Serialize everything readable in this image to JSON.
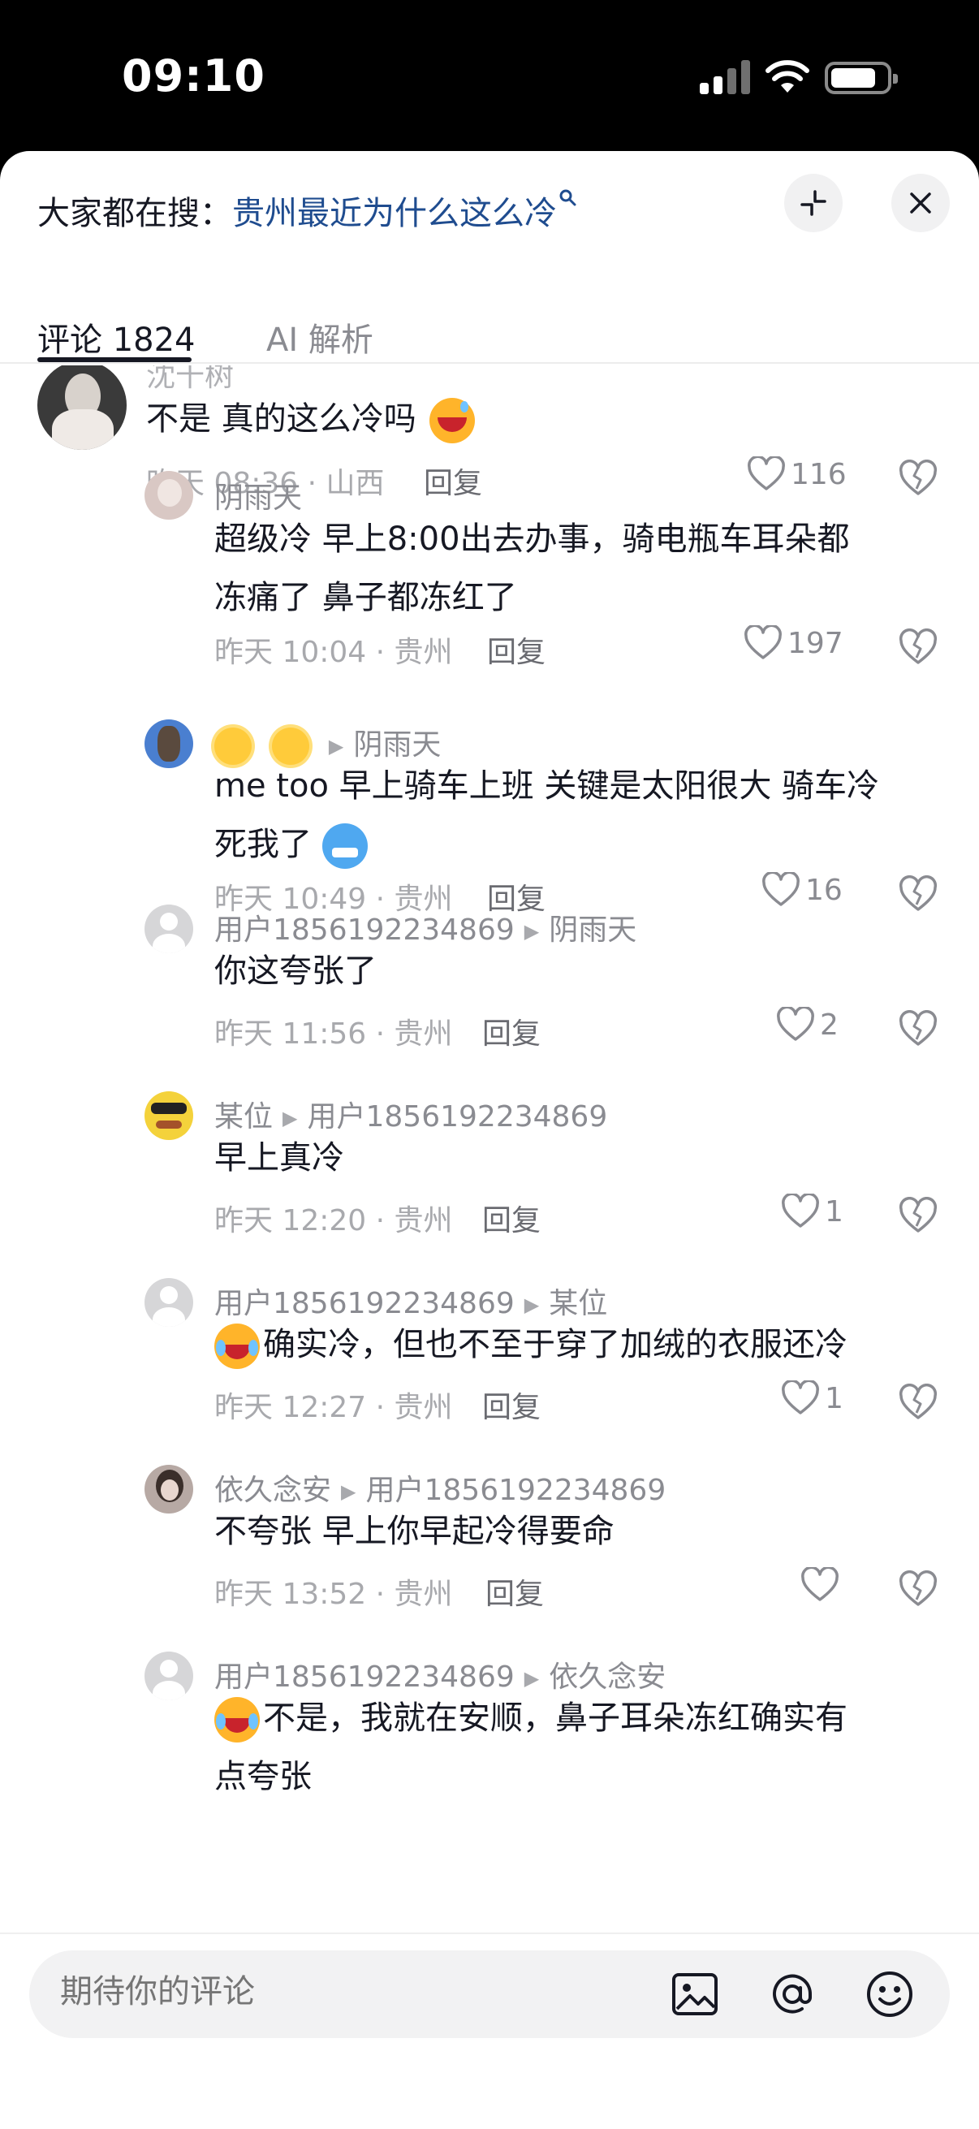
{
  "status_bar": {
    "time": "09:10"
  },
  "header": {
    "search_prefix": "大家都在搜：",
    "search_term": "贵州最近为什么这么冷"
  },
  "tabs": [
    {
      "label": "评论 1824",
      "active": true
    },
    {
      "label": "AI 解析",
      "active": false
    }
  ],
  "comments": [
    {
      "user": "沈十树",
      "text": "不是 真的这么冷吗",
      "time": "昨天 08:36 · 山西",
      "reply": "回复",
      "likes": "116"
    },
    {
      "user": "阴雨天",
      "text_lines": [
        "超级冷 早上8:00出去办事，骑电瓶车耳朵都",
        "冻痛了 鼻子都冻红了"
      ],
      "time": "昨天 10:04 · 贵州",
      "reply": "回复",
      "likes": "197"
    },
    {
      "user": "阴雨天",
      "text_lines": [
        "me too 早上骑车上班 关键是太阳很大 骑车冷",
        "死我了"
      ],
      "time": "昨天 10:49 · 贵州",
      "reply": "回复",
      "likes": "16"
    },
    {
      "user": "用户1856192234869",
      "to": "阴雨天",
      "text": "你这夸张了",
      "time": "昨天 11:56 · 贵州",
      "reply": "回复",
      "likes": "2"
    },
    {
      "user": "某位",
      "to": "用户1856192234869",
      "text": "早上真冷",
      "time": "昨天 12:20 · 贵州",
      "reply": "回复",
      "likes": "1"
    },
    {
      "user": "用户1856192234869",
      "to": "某位",
      "text": "确实冷，但也不至于穿了加绒的衣服还冷",
      "time": "昨天 12:27 · 贵州",
      "reply": "回复",
      "likes": "1"
    },
    {
      "user": "依久念安",
      "to": "用户1856192234869",
      "text": "不夸张 早上你早起冷得要命",
      "time": "昨天 13:52 · 贵州",
      "reply": "回复",
      "likes": ""
    },
    {
      "user": "用户1856192234869",
      "to": "依久念安",
      "text_lines": [
        "不是，我就在安顺，鼻子耳朵冻红确实有",
        "点夸张"
      ]
    }
  ],
  "composer": {
    "placeholder": "期待你的评论"
  },
  "colors": {
    "link": "#1f4c8f",
    "text": "#161823",
    "muted": "#a8a9ad"
  },
  "icons": [
    "search-icon",
    "minimize-icon",
    "close-icon",
    "heart-icon",
    "dislike-icon",
    "image-icon",
    "mention-icon",
    "emoji-icon"
  ]
}
